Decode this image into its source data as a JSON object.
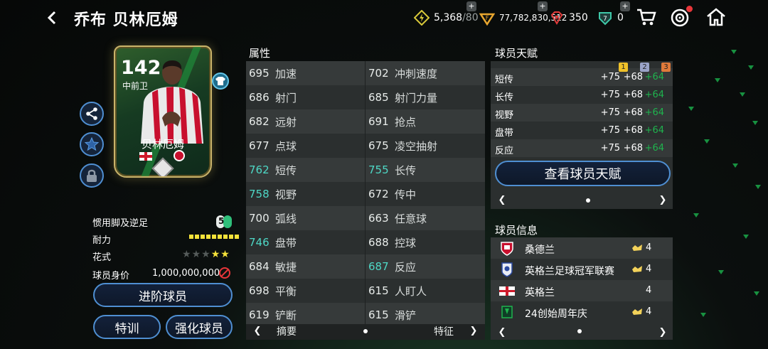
{
  "header": {
    "title": "乔布 贝林厄姆",
    "currencies": [
      {
        "name": "energy",
        "value": "5,368",
        "max": "/80",
        "icon": "lightning-icon",
        "has_plus": true
      },
      {
        "name": "coins",
        "value": "77,782,830,512",
        "icon": "coin-icon",
        "has_plus": true
      },
      {
        "name": "gems",
        "value": "350",
        "icon": "gem-icon",
        "has_plus": false
      },
      {
        "name": "tokens",
        "value": "0",
        "icon": "shield-token-icon",
        "has_plus": true
      }
    ]
  },
  "card": {
    "rating": "142",
    "position": "中前卫",
    "name": "贝林厄姆"
  },
  "left_info": {
    "foot_label": "惯用脚及逆足",
    "foot_value": "5",
    "stamina_label": "耐力",
    "stamina_level": 9,
    "skill_label": "花式",
    "skill_stars": 2,
    "skill_max": 5,
    "value_label": "球员身价",
    "value_amount": "1,000,000,000"
  },
  "buttons": {
    "advance": "进阶球员",
    "train": "特训",
    "upgrade": "强化球员",
    "view_talent": "查看球员天赋"
  },
  "attributes": {
    "title": "属性",
    "rows": [
      {
        "lv": "695",
        "ln": "加速",
        "lh": false,
        "rv": "702",
        "rn": "冲刺速度",
        "rh": false
      },
      {
        "lv": "686",
        "ln": "射门",
        "lh": false,
        "rv": "685",
        "rn": "射门力量",
        "rh": false
      },
      {
        "lv": "682",
        "ln": "远射",
        "lh": false,
        "rv": "691",
        "rn": "抢点",
        "rh": false
      },
      {
        "lv": "677",
        "ln": "点球",
        "lh": false,
        "rv": "675",
        "rn": "凌空抽射",
        "rh": false
      },
      {
        "lv": "762",
        "ln": "短传",
        "lh": true,
        "rv": "755",
        "rn": "长传",
        "rh": true
      },
      {
        "lv": "758",
        "ln": "视野",
        "lh": true,
        "rv": "672",
        "rn": "传中",
        "rh": false
      },
      {
        "lv": "700",
        "ln": "弧线",
        "lh": false,
        "rv": "663",
        "rn": "任意球",
        "rh": false
      },
      {
        "lv": "746",
        "ln": "盘带",
        "lh": true,
        "rv": "688",
        "rn": "控球",
        "rh": false
      },
      {
        "lv": "684",
        "ln": "敏捷",
        "lh": false,
        "rv": "687",
        "rn": "反应",
        "rh": true
      },
      {
        "lv": "698",
        "ln": "平衡",
        "lh": false,
        "rv": "615",
        "rn": "人盯人",
        "rh": false
      },
      {
        "lv": "619",
        "ln": "铲断",
        "lh": false,
        "rv": "615",
        "rn": "滑铲",
        "rh": false
      }
    ],
    "footer_left": "摘要",
    "footer_right": "特征"
  },
  "talent": {
    "title": "球员天赋",
    "tiers": [
      "1",
      "2",
      "3"
    ],
    "tier_colors": [
      "#f0c22a",
      "#9aa3c8",
      "#e07a3a"
    ],
    "rows": [
      {
        "name": "短传",
        "b1": "+75",
        "b2": "+68",
        "b3": "+64"
      },
      {
        "name": "长传",
        "b1": "+75",
        "b2": "+68",
        "b3": "+64"
      },
      {
        "name": "视野",
        "b1": "+75",
        "b2": "+68",
        "b3": "+64"
      },
      {
        "name": "盘带",
        "b1": "+75",
        "b2": "+68",
        "b3": "+64"
      },
      {
        "name": "反应",
        "b1": "+75",
        "b2": "+68",
        "b3": "+64"
      }
    ]
  },
  "player_info": {
    "title": "球员信息",
    "rows": [
      {
        "name": "桑德兰",
        "chem": "4",
        "icon": "club-crest-icon",
        "has_chem_icon": true
      },
      {
        "name": "英格兰足球冠军联赛",
        "chem": "4",
        "icon": "league-logo-icon",
        "has_chem_icon": true
      },
      {
        "name": "英格兰",
        "chem": "4",
        "icon": "england-flag-icon",
        "has_chem_icon": false
      },
      {
        "name": "24创始周年庆",
        "chem": "4",
        "icon": "program-badge-icon",
        "has_chem_icon": true
      }
    ]
  },
  "colors": {
    "accent_blue": "#4f8fd2",
    "highlight_teal": "#4ed8c6",
    "gold": "#c9b36a",
    "talent_green": "#1fb34e"
  }
}
